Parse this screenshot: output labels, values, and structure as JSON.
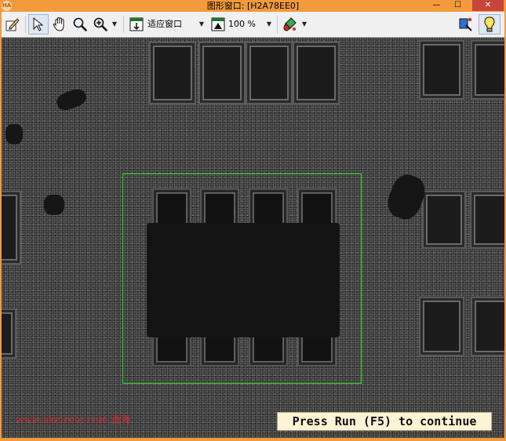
{
  "window": {
    "title": "图形窗口: [H2A78EE0]",
    "app_icon": "HA",
    "minimize_glyph": "—",
    "maximize_glyph": "☐",
    "close_glyph": "✕"
  },
  "toolbar": {
    "icons": [
      "edit-icon",
      "pointer-icon",
      "hand-pan-icon",
      "magnifier-icon",
      "zoom-in-icon",
      "fit-window-icon",
      "zoom-percent-icon",
      "paint-icon",
      "pin-icon",
      "lightbulb-icon"
    ],
    "fit_label": "适应窗口",
    "zoom_label": "100 %",
    "dropdown_arrow": "▼"
  },
  "canvas": {
    "roi_color": "#22e022",
    "watermark": "www.skcircle.com 勇哥",
    "prompt": "Press Run (F5) to continue"
  },
  "colors": {
    "frame": "#f29a3c",
    "close_button": "#c7453a",
    "toolbar_bg": "#f0f0f0"
  }
}
